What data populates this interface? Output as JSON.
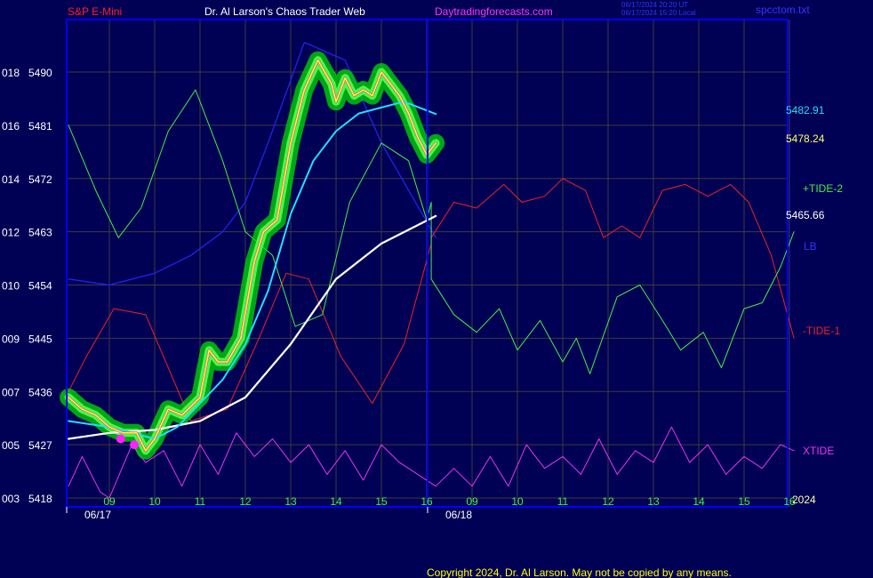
{
  "header": {
    "symbol": "S&P E-Mini",
    "publisher": "Dr. Al Larson's Chaos Trader Web",
    "website": "Daytradingforecasts.com",
    "timestamp_ut": "06/17/2024 20:20 UT",
    "timestamp_local": "06/17/2024 15:20 Local",
    "source_file": "spcctom.txt"
  },
  "footer": {
    "copyright": "Copyright 2024, Dr. Al Larson. May not be copied by any means."
  },
  "y_axis": {
    "labels": [
      {
        "tide": "018",
        "price": "5490",
        "value": 5490
      },
      {
        "tide": "016",
        "price": "5481",
        "value": 5481
      },
      {
        "tide": "014",
        "price": "5472",
        "value": 5472
      },
      {
        "tide": "012",
        "price": "5463",
        "value": 5463
      },
      {
        "tide": "010",
        "price": "5454",
        "value": 5454
      },
      {
        "tide": "009",
        "price": "5445",
        "value": 5445
      },
      {
        "tide": "007",
        "price": "5436",
        "value": 5436
      },
      {
        "tide": "005",
        "price": "5427",
        "value": 5427
      },
      {
        "tide": "003",
        "price": "5418",
        "value": 5418
      }
    ]
  },
  "x_axis": {
    "hours": [
      "09",
      "10",
      "11",
      "12",
      "13",
      "14",
      "15",
      "16",
      "09",
      "10",
      "11",
      "12",
      "13",
      "14",
      "15",
      "16"
    ],
    "dates": [
      "06/17",
      "06/18"
    ],
    "year": "2024"
  },
  "right_labels": {
    "price_cyan": "5482.91",
    "price_yellow": "5478.24",
    "price_white": "5465.66",
    "tide2": "+TIDE-2",
    "lb": "LB",
    "tide1": "-TIDE-1",
    "xtide": "XTIDE"
  },
  "colors": {
    "background": "#000055",
    "frame": "#0000ff",
    "grid": "#3c3c3c",
    "title_red": "#ff2020",
    "website_magenta": "#ff33ff",
    "price": "#ffff00",
    "price_glow": "#00dd00",
    "ema_fast": "#22ddff",
    "ema_slow": "#ffffff",
    "tide2": "#44ee44",
    "lb": "#2222ee",
    "tide1": "#ee2222",
    "xtide": "#ee33ee"
  },
  "chart_data": {
    "type": "line",
    "title": "S&P E-Mini",
    "ylim": [
      5418,
      5500
    ],
    "x_unit": "hour slot (0 = 09:00 06/17, 8 = 09:00 06/18, 15 = 16:00 06/18)",
    "last_values": {
      "ema_fast": 5482.91,
      "price": 5478.24,
      "ema_slow": 5465.66
    },
    "series": [
      {
        "name": "Price",
        "x": [
          -0.9,
          -0.6,
          -0.3,
          0,
          0.3,
          0.6,
          0.8,
          1,
          1.3,
          1.6,
          2,
          2.2,
          2.4,
          2.6,
          2.9,
          3.2,
          3.4,
          3.7,
          4,
          4.3,
          4.6,
          4.9,
          5,
          5.2,
          5.4,
          5.6,
          5.8,
          6,
          6.2,
          6.4,
          6.6,
          6.8,
          7.0,
          7.2
        ],
        "values": [
          5435,
          5433,
          5432,
          5430,
          5429,
          5429,
          5426,
          5428,
          5433,
          5432,
          5435,
          5443,
          5441,
          5441,
          5445,
          5458,
          5463,
          5465,
          5478,
          5487,
          5492,
          5488,
          5485,
          5489,
          5486,
          5487,
          5486,
          5490,
          5488,
          5486,
          5483,
          5479,
          5476,
          5478
        ]
      },
      {
        "name": "EMA fast",
        "x": [
          -0.9,
          0,
          0.5,
          1,
          1.5,
          2,
          2.5,
          3,
          3.5,
          4,
          4.5,
          5,
          5.5,
          6,
          6.5,
          7.2
        ],
        "values": [
          5431,
          5430,
          5429,
          5428,
          5430,
          5434,
          5438,
          5444,
          5453,
          5466,
          5475,
          5480,
          5483,
          5484,
          5485,
          5482.91
        ]
      },
      {
        "name": "EMA slow",
        "x": [
          -0.9,
          0,
          1,
          2,
          3,
          4,
          5,
          6,
          7.2
        ],
        "values": [
          5428,
          5429,
          5429.5,
          5431,
          5435,
          5444,
          5455,
          5461,
          5465.66
        ]
      },
      {
        "name": "+TIDE-2",
        "x": [
          -0.9,
          -0.3,
          0.2,
          0.7,
          1.3,
          1.9,
          2.5,
          3.0,
          3.6,
          4.1,
          4.7,
          5.3,
          6,
          6.6,
          7.0,
          7.1,
          7.1,
          7.6,
          8.1,
          8.6,
          9.0,
          9.5,
          10,
          10.3,
          10.6,
          11.2,
          11.7,
          12.2,
          12.6,
          13.1,
          13.5,
          14,
          14.4,
          14.8,
          15.1
        ],
        "values": [
          5481,
          5470,
          5462,
          5467,
          5480,
          5487,
          5475,
          5463,
          5459,
          5447,
          5449,
          5468,
          5478,
          5475,
          5465,
          5468,
          5455,
          5449,
          5446,
          5450,
          5443,
          5448,
          5441,
          5445,
          5439,
          5452,
          5454,
          5448,
          5443,
          5446,
          5440,
          5450,
          5451,
          5457,
          5463
        ]
      },
      {
        "name": "LB",
        "x": [
          -0.9,
          0,
          1,
          1.8,
          2.5,
          3.0,
          3.5,
          4.3,
          5.2,
          6.0,
          7.2
        ],
        "values": [
          5455,
          5454,
          5456,
          5459,
          5463,
          5468,
          5478,
          5495,
          5492,
          5478,
          5462
        ]
      },
      {
        "name": "-TIDE-1",
        "x": [
          -0.9,
          -0.5,
          0.1,
          0.8,
          1.3,
          1.8,
          2.6,
          3.3,
          3.9,
          4.4,
          5.1,
          5.8,
          6.5,
          7.1,
          7.1,
          7.6,
          8.1,
          8.7,
          9.1,
          9.6,
          10.0,
          10.5,
          10.9,
          11.3,
          11.7,
          12.2,
          12.7,
          13.2,
          13.7,
          14.1,
          14.6,
          15.1
        ],
        "values": [
          5436,
          5442,
          5450,
          5449,
          5440,
          5431,
          5433,
          5445,
          5456,
          5455,
          5442,
          5434,
          5444,
          5461,
          5462,
          5468,
          5467,
          5471,
          5468,
          5469,
          5472,
          5470,
          5462,
          5464,
          5462,
          5470,
          5471,
          5469,
          5471,
          5468,
          5459,
          5445
        ]
      },
      {
        "name": "XTIDE",
        "x": [
          -0.9,
          -0.6,
          -0.2,
          0,
          0.5,
          0.8,
          1.2,
          1.6,
          2,
          2.4,
          2.8,
          3.2,
          3.6,
          4,
          4.4,
          4.8,
          5.2,
          5.6,
          6,
          6.4,
          6.8,
          7.2,
          7.6,
          8,
          8.4,
          8.8,
          9.2,
          9.6,
          10,
          10.4,
          10.8,
          11.2,
          11.6,
          12,
          12.4,
          12.8,
          13.2,
          13.6,
          14,
          14.4,
          14.8,
          15.1
        ],
        "values": [
          5420,
          5425,
          5419,
          5418,
          5427,
          5424,
          5426,
          5420,
          5427,
          5422,
          5429,
          5425,
          5428,
          5424,
          5427,
          5422,
          5426,
          5421,
          5427,
          5424,
          5422,
          5420,
          5423,
          5420,
          5425,
          5420,
          5427,
          5423,
          5425,
          5422,
          5428,
          5422,
          5426,
          5424,
          5430,
          5424,
          5427,
          5422,
          5425,
          5423,
          5427,
          5426
        ]
      }
    ]
  }
}
